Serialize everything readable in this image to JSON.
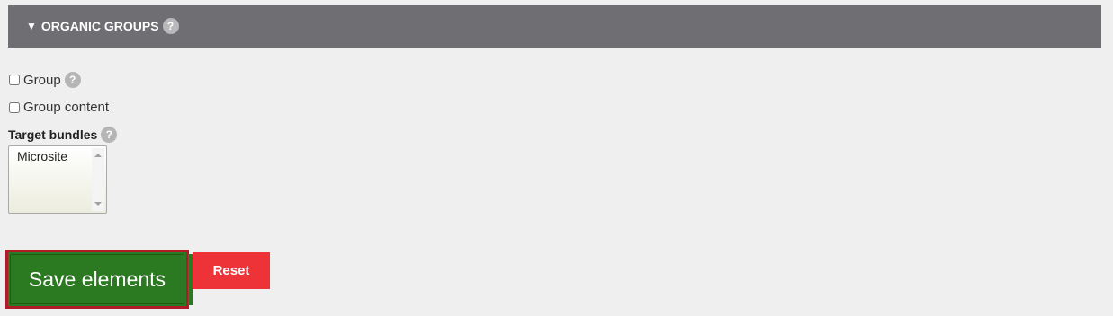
{
  "fieldset": {
    "title": "ORGANIC GROUPS",
    "caret_glyph": "▼",
    "help_glyph": "?"
  },
  "options": {
    "group": {
      "label": "Group",
      "checked": false,
      "help_glyph": "?"
    },
    "group_content": {
      "label": "Group content",
      "checked": false
    }
  },
  "target_bundles": {
    "label": "Target bundles",
    "help_glyph": "?",
    "items": [
      "Microsite"
    ]
  },
  "actions": {
    "save_label": "Save elements",
    "reset_label": "Reset"
  },
  "colors": {
    "header_bg": "#6f6f73",
    "page_bg": "#efefef",
    "save_bg": "#2b7a22",
    "save_border": "#b01b2a",
    "reset_bg": "#ee3338"
  }
}
